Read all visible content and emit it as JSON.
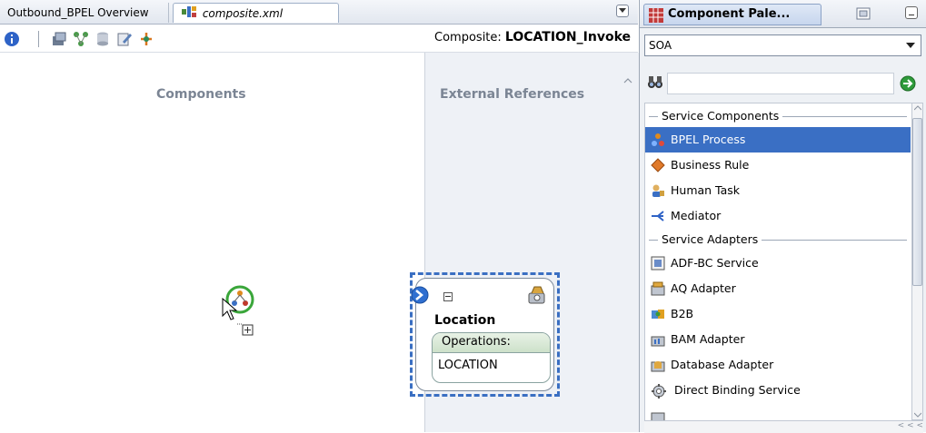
{
  "editor": {
    "tabs": [
      {
        "label": "Outbound_BPEL Overview"
      },
      {
        "label": "composite.xml"
      }
    ],
    "composite_label": "Composite:",
    "composite_name": "LOCATION_Invoke",
    "lanes": {
      "components": "Components",
      "external": "External References"
    },
    "reference": {
      "name": "Location",
      "operations_header": "Operations:",
      "operation": "LOCATION"
    }
  },
  "palette": {
    "title": "Component Pale...",
    "category": "SOA",
    "search_value": "",
    "sections": [
      {
        "header": "Service Components",
        "items": [
          {
            "label": "BPEL Process",
            "icon": "bpel-process-icon",
            "selected": true
          },
          {
            "label": "Business Rule",
            "icon": "business-rule-icon"
          },
          {
            "label": "Human Task",
            "icon": "human-task-icon"
          },
          {
            "label": "Mediator",
            "icon": "mediator-icon"
          }
        ]
      },
      {
        "header": "Service Adapters",
        "items": [
          {
            "label": "ADF-BC Service",
            "icon": "adf-bc-service-icon"
          },
          {
            "label": "AQ Adapter",
            "icon": "aq-adapter-icon"
          },
          {
            "label": "B2B",
            "icon": "b2b-icon"
          },
          {
            "label": "BAM Adapter",
            "icon": "bam-adapter-icon"
          },
          {
            "label": "Database Adapter",
            "icon": "database-adapter-icon"
          },
          {
            "label": "Direct Binding Service",
            "icon": "direct-binding-service-icon"
          }
        ]
      }
    ],
    "hscroll_marker": "< < <"
  },
  "colors": {
    "selection": "#3a6fc4",
    "dashed_selection": "#3a6fc2",
    "drop_ring": "#3aa63a"
  }
}
